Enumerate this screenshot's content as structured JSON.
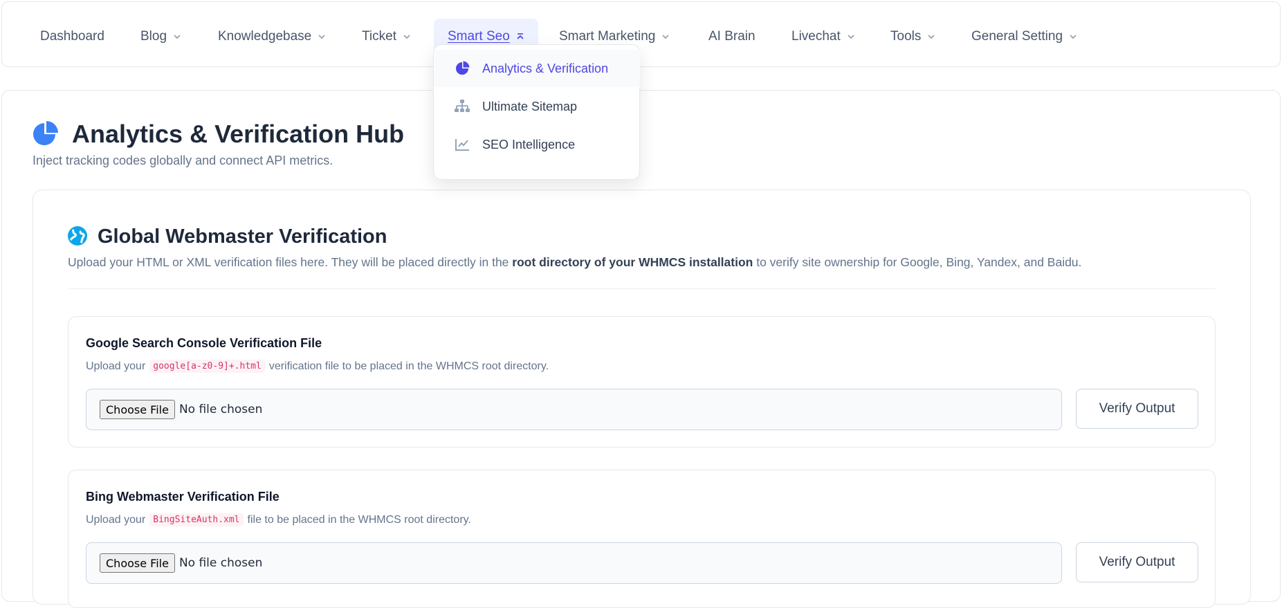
{
  "nav": {
    "items": [
      {
        "label": "Dashboard",
        "dropdown": false
      },
      {
        "label": "Blog",
        "dropdown": true
      },
      {
        "label": "Knowledgebase",
        "dropdown": true
      },
      {
        "label": "Ticket",
        "dropdown": true
      },
      {
        "label": "Smart Seo",
        "dropdown": true,
        "active": true
      },
      {
        "label": "Smart Marketing",
        "dropdown": true
      },
      {
        "label": "AI Brain",
        "dropdown": false
      },
      {
        "label": "Livechat",
        "dropdown": true
      },
      {
        "label": "Tools",
        "dropdown": true
      },
      {
        "label": "General Setting",
        "dropdown": true
      }
    ]
  },
  "dropdown": {
    "items": [
      {
        "label": "Analytics & Verification",
        "icon": "pie-chart-icon",
        "active": true
      },
      {
        "label": "Ultimate Sitemap",
        "icon": "sitemap-icon"
      },
      {
        "label": "SEO Intelligence",
        "icon": "line-chart-icon"
      }
    ]
  },
  "page": {
    "title": "Analytics & Verification Hub",
    "subtitle": "Inject tracking codes globally and connect API metrics."
  },
  "section": {
    "title": "Global Webmaster Verification",
    "desc_before": "Upload your HTML or XML verification files here. They will be placed directly in the ",
    "desc_bold": "root directory of your WHMCS installation",
    "desc_after": " to verify site ownership for Google, Bing, Yandex, and Baidu."
  },
  "files": [
    {
      "title": "Google Search Console Verification File",
      "desc_before": "Upload your",
      "code": "google[a-z0-9]+.html",
      "desc_after": "verification file to be placed in the WHMCS root directory.",
      "choose_label": "Choose File",
      "status": "No file chosen",
      "verify_label": "Verify Output"
    },
    {
      "title": "Bing Webmaster Verification File",
      "desc_before": "Upload your",
      "code": "BingSiteAuth.xml",
      "desc_after": "file to be placed in the WHMCS root directory.",
      "choose_label": "Choose File",
      "status": "No file chosen",
      "verify_label": "Verify Output"
    }
  ],
  "colors": {
    "accent": "#4f46e5",
    "hub_icon": "#3b82f6",
    "globe_icon": "#0ea5e9",
    "code_text": "#d6336c"
  }
}
